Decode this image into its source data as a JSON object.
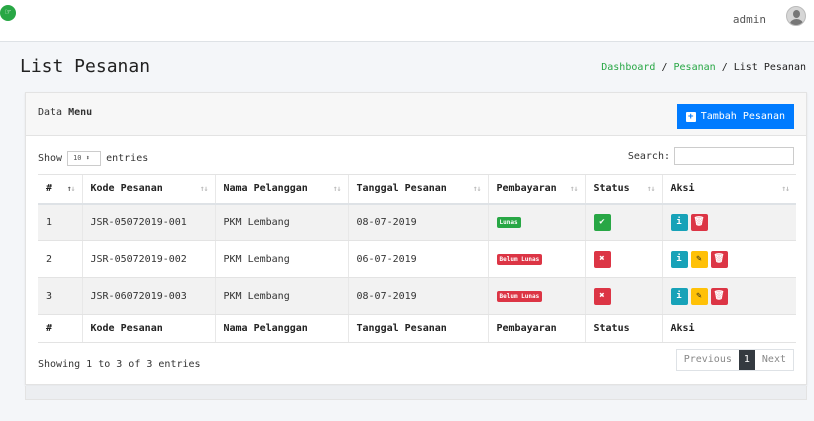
{
  "header": {
    "user_name": "admin"
  },
  "page": {
    "title": "List Pesanan",
    "breadcrumb": [
      "Dashboard",
      "Pesanan",
      "List Pesanan"
    ]
  },
  "card": {
    "title_prefix": "Data ",
    "title_bold": "Menu",
    "add_button": "Tambah Pesanan"
  },
  "controls": {
    "show_label": "Show",
    "length_value": "10",
    "entries_label": "entries",
    "search_label": "Search:"
  },
  "table": {
    "columns": [
      "#",
      "Kode Pesanan",
      "Nama Pelanggan",
      "Tanggal Pesanan",
      "Pembayaran",
      "Status",
      "Aksi"
    ],
    "rows": [
      {
        "no": "1",
        "kode": "JSR-05072019-001",
        "nama": "PKM Lembang",
        "tanggal": "08-07-2019",
        "pembayaran": "Lunas",
        "status": "done"
      },
      {
        "no": "2",
        "kode": "JSR-05072019-002",
        "nama": "PKM Lembang",
        "tanggal": "06-07-2019",
        "pembayaran": "Belum Lunas",
        "status": "pending"
      },
      {
        "no": "3",
        "kode": "JSR-06072019-003",
        "nama": "PKM Lembang",
        "tanggal": "08-07-2019",
        "pembayaran": "Belum Lunas",
        "status": "pending"
      }
    ]
  },
  "footer": {
    "info": "Showing 1 to 3 of 3 entries",
    "previous": "Previous",
    "page": "1",
    "next": "Next"
  },
  "colors": {
    "primary": "#007bff",
    "success": "#28a745",
    "danger": "#dc3545",
    "info": "#17a2b8",
    "warning": "#ffc107"
  }
}
